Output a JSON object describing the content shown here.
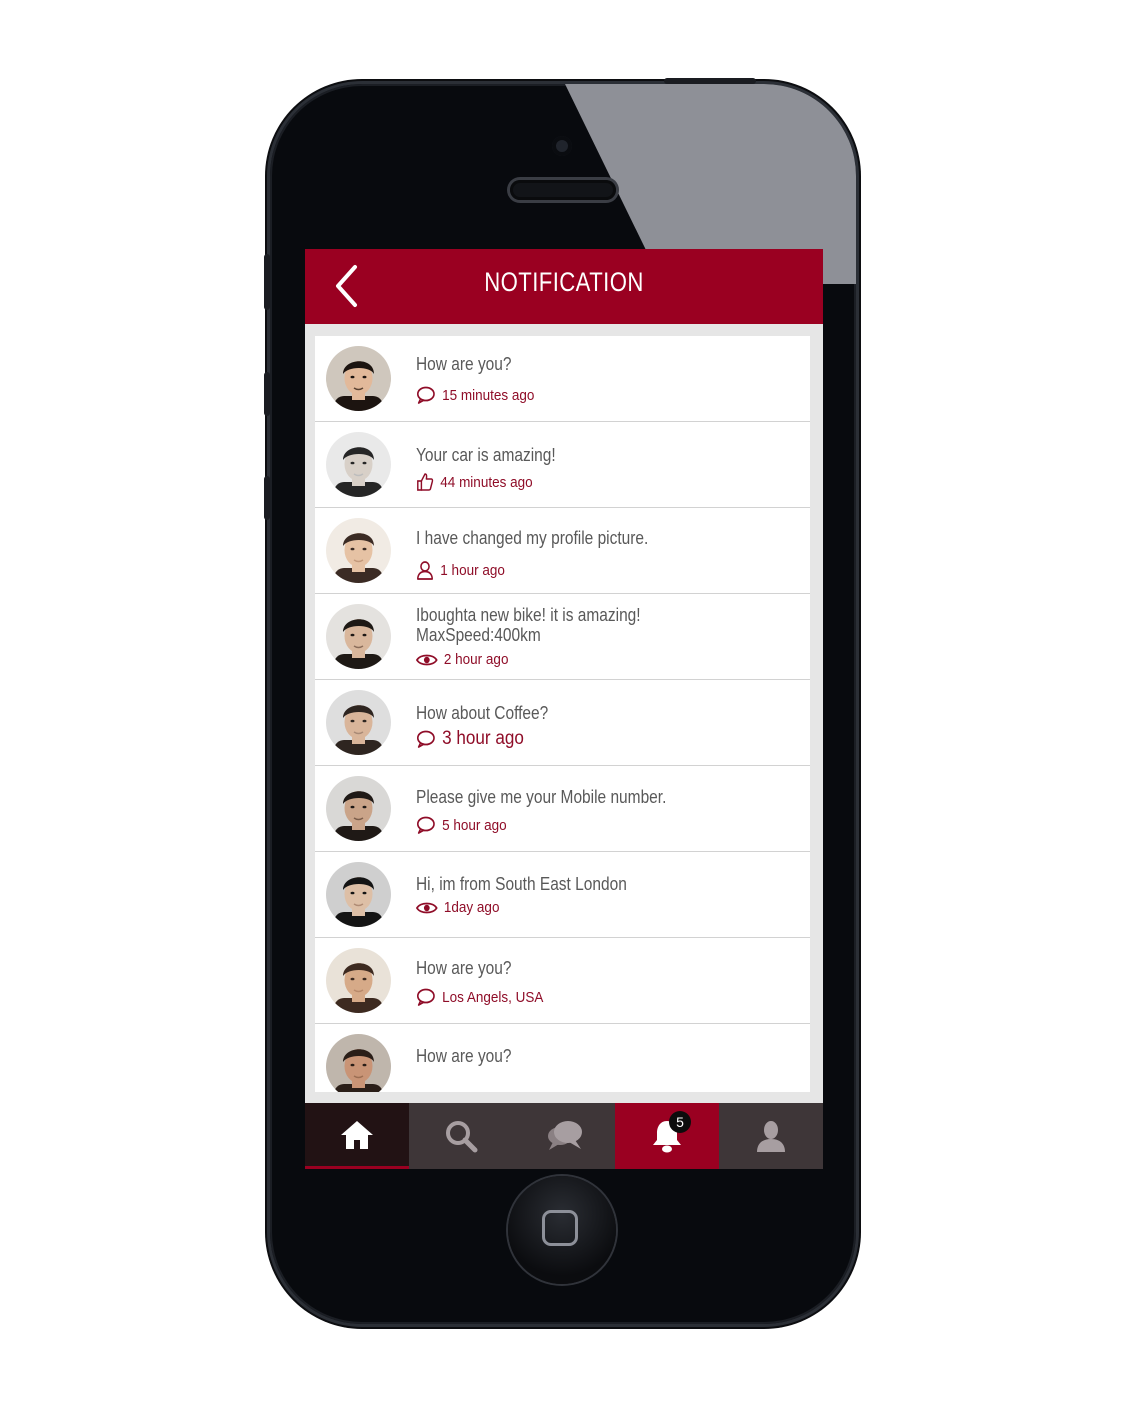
{
  "app": {
    "title": "NOTIFICATION",
    "accent_color": "#9a0021",
    "tabbar_color": "#3e3638"
  },
  "notifications": [
    {
      "message": "How are you?",
      "meta": "15 minutes ago",
      "icon": "comment-icon"
    },
    {
      "message": "Your car is amazing!",
      "meta": "44 minutes ago",
      "icon": "thumbs-up-icon"
    },
    {
      "message": "I have changed my profile picture.",
      "meta": "1 hour ago",
      "icon": "user-icon"
    },
    {
      "message": "Iboughta new bike! it is amazing!\nMaxSpeed:400km",
      "meta": "2 hour ago",
      "icon": "eye-icon"
    },
    {
      "message": "How about Coffee?",
      "meta": "3 hour ago",
      "icon": "comment-icon"
    },
    {
      "message": "Please give me your Mobile number.",
      "meta": "5 hour ago",
      "icon": "comment-icon"
    },
    {
      "message": "Hi, im from South East London",
      "meta": "1day ago",
      "icon": "eye-icon"
    },
    {
      "message": "How are you?",
      "meta": "Los Angels, USA",
      "icon": "comment-icon"
    },
    {
      "message": "How are you?",
      "meta": "",
      "icon": ""
    }
  ],
  "tabbar": {
    "tabs": [
      {
        "icon": "home-icon",
        "active": true
      },
      {
        "icon": "search-icon",
        "active": false
      },
      {
        "icon": "chat-icon",
        "active": false
      },
      {
        "icon": "bell-icon",
        "active": false,
        "badge": "5"
      },
      {
        "icon": "profile-icon",
        "active": false
      }
    ]
  }
}
